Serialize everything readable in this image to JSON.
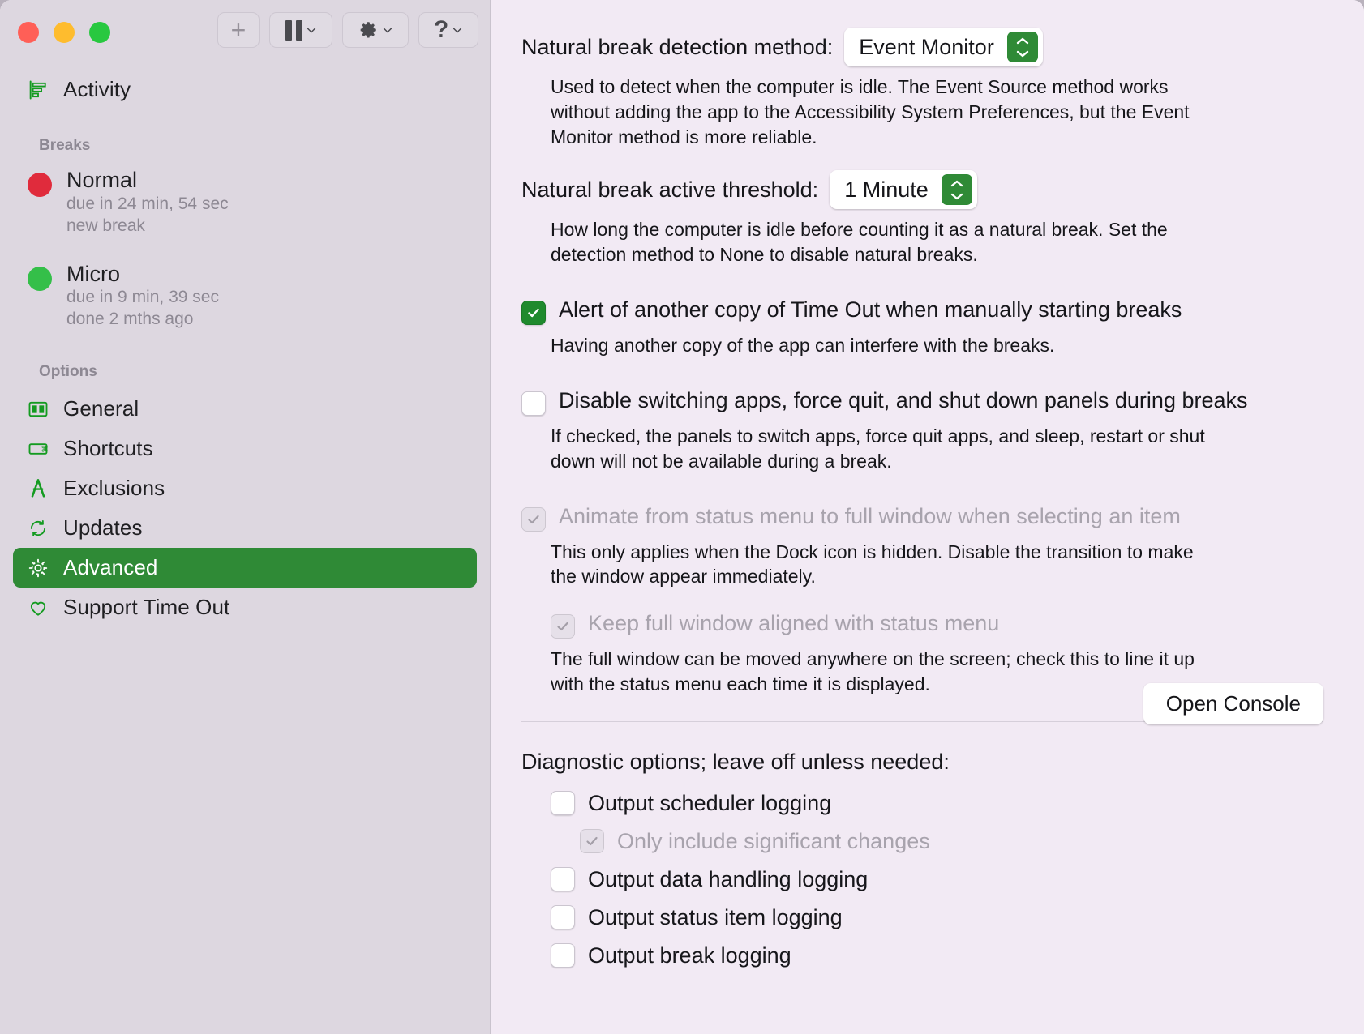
{
  "window": {
    "traffic_lights": [
      "close",
      "minimize",
      "zoom"
    ],
    "toolbar": [
      {
        "name": "add-button",
        "icon": "plus-icon",
        "label": "+",
        "enabled": false
      },
      {
        "name": "pause-button",
        "icon": "pause-icon",
        "label": "",
        "has_chevron": true
      },
      {
        "name": "settings-button",
        "icon": "gear-icon",
        "label": "",
        "has_chevron": true
      },
      {
        "name": "help-button",
        "icon": "question-mark-icon",
        "label": "?",
        "has_chevron": true
      }
    ]
  },
  "sidebar": {
    "activity": {
      "label": "Activity",
      "icon": "activity-chart-icon"
    },
    "breaks_group_title": "Breaks",
    "breaks": [
      {
        "name": "Normal",
        "color": "#e02b3c",
        "due": "due in 24 min, 54 sec",
        "status": "new break"
      },
      {
        "name": "Micro",
        "color": "#34bf49",
        "due": "due in 9 min, 39 sec",
        "status": "done 2 mths ago"
      }
    ],
    "options_group_title": "Options",
    "options": [
      {
        "label": "General",
        "icon": "panels-icon",
        "selected": false
      },
      {
        "label": "Shortcuts",
        "icon": "keyboard-icon",
        "selected": false
      },
      {
        "label": "Exclusions",
        "icon": "compass-icon",
        "selected": false
      },
      {
        "label": "Updates",
        "icon": "refresh-icon",
        "selected": false
      },
      {
        "label": "Advanced",
        "icon": "gear-icon",
        "selected": true
      },
      {
        "label": "Support Time Out",
        "icon": "heart-icon",
        "selected": false
      }
    ],
    "selection_color": "#2f8a36"
  },
  "main": {
    "detection_method": {
      "label": "Natural break detection method:",
      "value": "Event Monitor",
      "help": "Used to detect when the computer is idle.  The Event Source method works without adding the app to the Accessibility System Preferences, but the Event Monitor method is more reliable."
    },
    "active_threshold": {
      "label": "Natural break active threshold:",
      "value": "1 Minute",
      "help": "How long the computer is idle before counting it as a natural break. Set the detection method to None to disable natural breaks."
    },
    "checkboxes": [
      {
        "label": "Alert of another copy of Time Out when manually starting breaks",
        "checked": true,
        "enabled": true,
        "help": "Having another copy of the app can interfere with the breaks."
      },
      {
        "label": "Disable switching apps, force quit, and shut down panels during breaks",
        "checked": false,
        "enabled": true,
        "help": "If checked, the panels to switch apps, force quit apps, and sleep, restart or shut down will not be available during a break."
      },
      {
        "label": "Animate from status menu to full window when selecting an item",
        "checked": true,
        "enabled": false,
        "help": "This only applies when the Dock icon is hidden.  Disable the transition to make the window appear immediately."
      },
      {
        "label": "Keep full window aligned with status menu",
        "checked": true,
        "enabled": false,
        "help": "The full window can be moved anywhere on the screen; check this to line it up with the status menu each time it is displayed."
      }
    ],
    "diagnostics": {
      "title": "Diagnostic options; leave off unless needed:",
      "open_console_label": "Open Console",
      "items": [
        {
          "label": "Output scheduler logging",
          "checked": false,
          "enabled": true,
          "sub": false
        },
        {
          "label": "Only include significant changes",
          "checked": true,
          "enabled": false,
          "sub": true
        },
        {
          "label": "Output data handling logging",
          "checked": false,
          "enabled": true,
          "sub": false
        },
        {
          "label": "Output status item logging",
          "checked": false,
          "enabled": true,
          "sub": false
        },
        {
          "label": "Output break logging",
          "checked": false,
          "enabled": true,
          "sub": false
        }
      ]
    }
  },
  "colors": {
    "accent_green": "#2f8a36",
    "checkbox_green": "#1f8a2d",
    "sidebar_bg": "#ddd7e0",
    "main_bg": "#f2eaf4",
    "icon_green": "#149b21"
  }
}
